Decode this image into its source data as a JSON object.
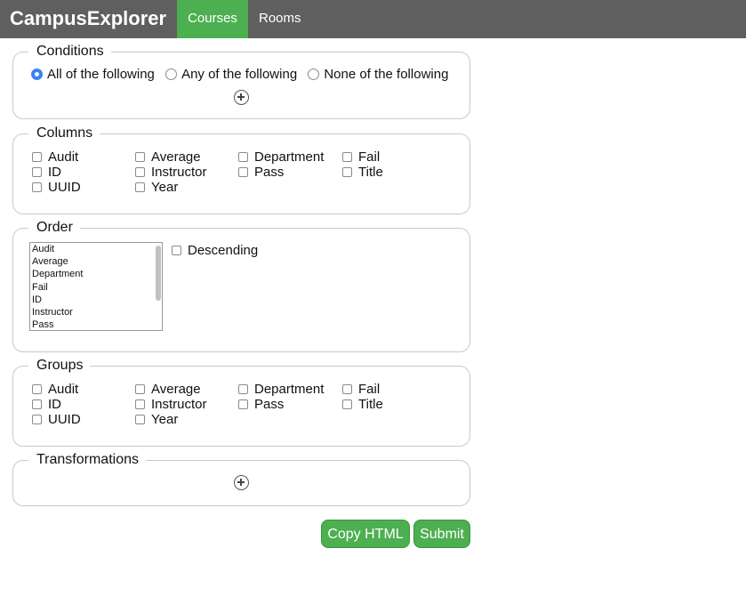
{
  "app": {
    "brand": "CampusExplorer"
  },
  "nav": {
    "tabs": [
      {
        "label": "Courses",
        "active": true
      },
      {
        "label": "Rooms",
        "active": false
      }
    ]
  },
  "conditions": {
    "legend": "Conditions",
    "options": [
      {
        "label": "All of the following",
        "checked": true
      },
      {
        "label": "Any of the following",
        "checked": false
      },
      {
        "label": "None of the following",
        "checked": false
      }
    ],
    "add_icon": "plus-circle-icon"
  },
  "columns": {
    "legend": "Columns",
    "items": [
      "Audit",
      "Average",
      "Department",
      "Fail",
      "ID",
      "Instructor",
      "Pass",
      "Title",
      "UUID",
      "Year"
    ]
  },
  "order": {
    "legend": "Order",
    "options": [
      "Audit",
      "Average",
      "Department",
      "Fail",
      "ID",
      "Instructor",
      "Pass"
    ],
    "descending_label": "Descending"
  },
  "groups": {
    "legend": "Groups",
    "items": [
      "Audit",
      "Average",
      "Department",
      "Fail",
      "ID",
      "Instructor",
      "Pass",
      "Title",
      "UUID",
      "Year"
    ]
  },
  "transformations": {
    "legend": "Transformations",
    "add_icon": "plus-circle-icon"
  },
  "buttons": {
    "copy_html": "Copy HTML",
    "submit": "Submit"
  },
  "colors": {
    "topbar": "#5f5f5f",
    "accent": "#4caf50",
    "radio_checked": "#3b82f6"
  }
}
